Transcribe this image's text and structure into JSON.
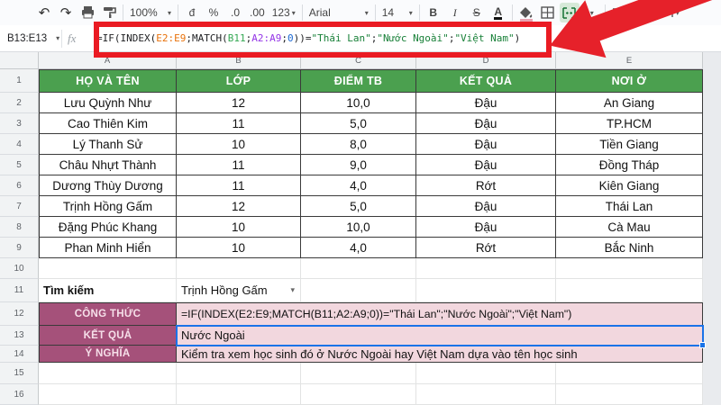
{
  "toolbar": {
    "zoom": "100%",
    "currency": "đ",
    "percent": "%",
    "decrease_decimal": ".0",
    "increase_decimal": ".00",
    "more_formats": "123",
    "font_family": "Arial",
    "font_size": "14",
    "bold": "B",
    "italic": "I",
    "strikethrough": "S",
    "text_color": "A"
  },
  "formula_bar": {
    "name_box": "B13:E13",
    "fx_label": "fx",
    "formula": "=IF(INDEX(E2:E9;MATCH(B11;A2:A9;0))=\"Thái Lan\";\"Nước Ngoài\";\"Việt Nam\")",
    "segments": [
      {
        "text": "=IF(INDEX(",
        "color": "#202124"
      },
      {
        "text": "E2:E9",
        "color": "#e8710a"
      },
      {
        "text": ";MATCH(",
        "color": "#202124"
      },
      {
        "text": "B11",
        "color": "#34a853"
      },
      {
        "text": ";",
        "color": "#202124"
      },
      {
        "text": "A2:A9",
        "color": "#9334e6"
      },
      {
        "text": ";",
        "color": "#202124"
      },
      {
        "text": "0",
        "color": "#1967d2"
      },
      {
        "text": "))=",
        "color": "#202124"
      },
      {
        "text": "\"Thái Lan\"",
        "color": "#188038"
      },
      {
        "text": ";",
        "color": "#202124"
      },
      {
        "text": "\"Nước Ngoài\"",
        "color": "#188038"
      },
      {
        "text": ";",
        "color": "#202124"
      },
      {
        "text": "\"Việt Nam\"",
        "color": "#188038"
      },
      {
        "text": ")",
        "color": "#202124"
      }
    ]
  },
  "sheet": {
    "column_letters": [
      "A",
      "B",
      "C",
      "D",
      "E"
    ],
    "row_numbers": [
      "1",
      "2",
      "3",
      "4",
      "5",
      "6",
      "7",
      "8",
      "9",
      "10",
      "11",
      "12",
      "13",
      "14",
      "15",
      "16"
    ],
    "header_row": [
      "HỌ VÀ TÊN",
      "LỚP",
      "ĐIỂM TB",
      "KẾT QUẢ",
      "NƠI Ở"
    ],
    "students": [
      {
        "name": "Lưu Quỳnh Như",
        "grade": "12",
        "score": "10,0",
        "result": "Đậu",
        "place": "An Giang"
      },
      {
        "name": "Cao Thiên Kim",
        "grade": "11",
        "score": "5,0",
        "result": "Đậu",
        "place": "TP.HCM"
      },
      {
        "name": "Lý Thanh Sử",
        "grade": "10",
        "score": "8,0",
        "result": "Đậu",
        "place": "Tiền Giang"
      },
      {
        "name": "Châu Nhựt Thành",
        "grade": "11",
        "score": "9,0",
        "result": "Đậu",
        "place": "Đồng Tháp"
      },
      {
        "name": "Dương Thùy Dương",
        "grade": "11",
        "score": "4,0",
        "result": "Rớt",
        "place": "Kiên Giang"
      },
      {
        "name": "Trịnh Hồng Gấm",
        "grade": "12",
        "score": "5,0",
        "result": "Đậu",
        "place": "Thái Lan"
      },
      {
        "name": "Đặng Phúc Khang",
        "grade": "10",
        "score": "10,0",
        "result": "Đậu",
        "place": "Cà Mau"
      },
      {
        "name": "Phan Minh Hiển",
        "grade": "10",
        "score": "4,0",
        "result": "Rớt",
        "place": "Bắc Ninh"
      }
    ],
    "search": {
      "label": "Tìm kiếm",
      "value": "Trịnh Hồng Gấm"
    },
    "info_rows": [
      {
        "label": "CÔNG THỨC",
        "value": "=IF(INDEX(E2:E9;MATCH(B11;A2:A9;0))=\"Thái Lan\";\"Nước Ngoài\";\"Việt Nam\")"
      },
      {
        "label": "KẾT QUẢ",
        "value": "Nước Ngoài"
      },
      {
        "label": "Ý NGHĨA",
        "value": "Kiểm tra xem học sinh đó ở Nước Ngoài hay Việt Nam dựa vào tên học sinh"
      }
    ],
    "selection_range": "B13:E13"
  },
  "colors": {
    "header_green": "#4ba04f",
    "label_maroon": "#a5517a",
    "light_pink": "#f2d7de",
    "selection_blue": "#1a73e8",
    "annotation_red": "#ea1b23"
  }
}
